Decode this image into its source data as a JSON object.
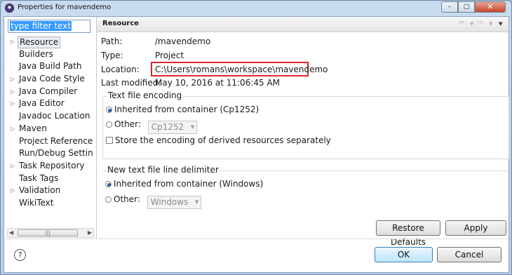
{
  "window": {
    "title": "Properties for mavendemo"
  },
  "filter": {
    "value": "type filter text"
  },
  "nav": {
    "items": [
      {
        "label": "Resource",
        "expandable": true,
        "selected": true
      },
      {
        "label": "Builders",
        "expandable": false
      },
      {
        "label": "Java Build Path",
        "expandable": false
      },
      {
        "label": "Java Code Style",
        "expandable": true
      },
      {
        "label": "Java Compiler",
        "expandable": true
      },
      {
        "label": "Java Editor",
        "expandable": true
      },
      {
        "label": "Javadoc Location",
        "expandable": false
      },
      {
        "label": "Maven",
        "expandable": true
      },
      {
        "label": "Project References",
        "expandable": false
      },
      {
        "label": "Run/Debug Settings",
        "expandable": false
      },
      {
        "label": "Task Repository",
        "expandable": true
      },
      {
        "label": "Task Tags",
        "expandable": false
      },
      {
        "label": "Validation",
        "expandable": true
      },
      {
        "label": "WikiText",
        "expandable": false
      }
    ]
  },
  "panel": {
    "heading": "Resource",
    "path_label": "Path:",
    "path_value": "/mavendemo",
    "type_label": "Type:",
    "type_value": "Project",
    "location_label": "Location:",
    "location_value": "C:\\Users\\romans\\workspace\\mavendemo",
    "modified_label": "Last modified:",
    "modified_value": "May 10, 2016 at 11:06:45 AM"
  },
  "encoding": {
    "title": "Text file encoding",
    "inherited_label": "Inherited from container (Cp1252)",
    "other_label": "Other:",
    "other_value": "Cp1252",
    "store_label": "Store the encoding of derived resources separately"
  },
  "delimiter": {
    "title": "New text file line delimiter",
    "inherited_label": "Inherited from container (Windows)",
    "other_label": "Other:",
    "other_value": "Windows"
  },
  "buttons": {
    "restore_defaults": "Restore Defaults",
    "apply": "Apply",
    "ok": "OK",
    "cancel": "Cancel"
  },
  "colors": {
    "highlight_border": "#e0282e",
    "selection": "#3399ff"
  },
  "icons": {
    "help": "help-icon",
    "close": "close-icon"
  }
}
